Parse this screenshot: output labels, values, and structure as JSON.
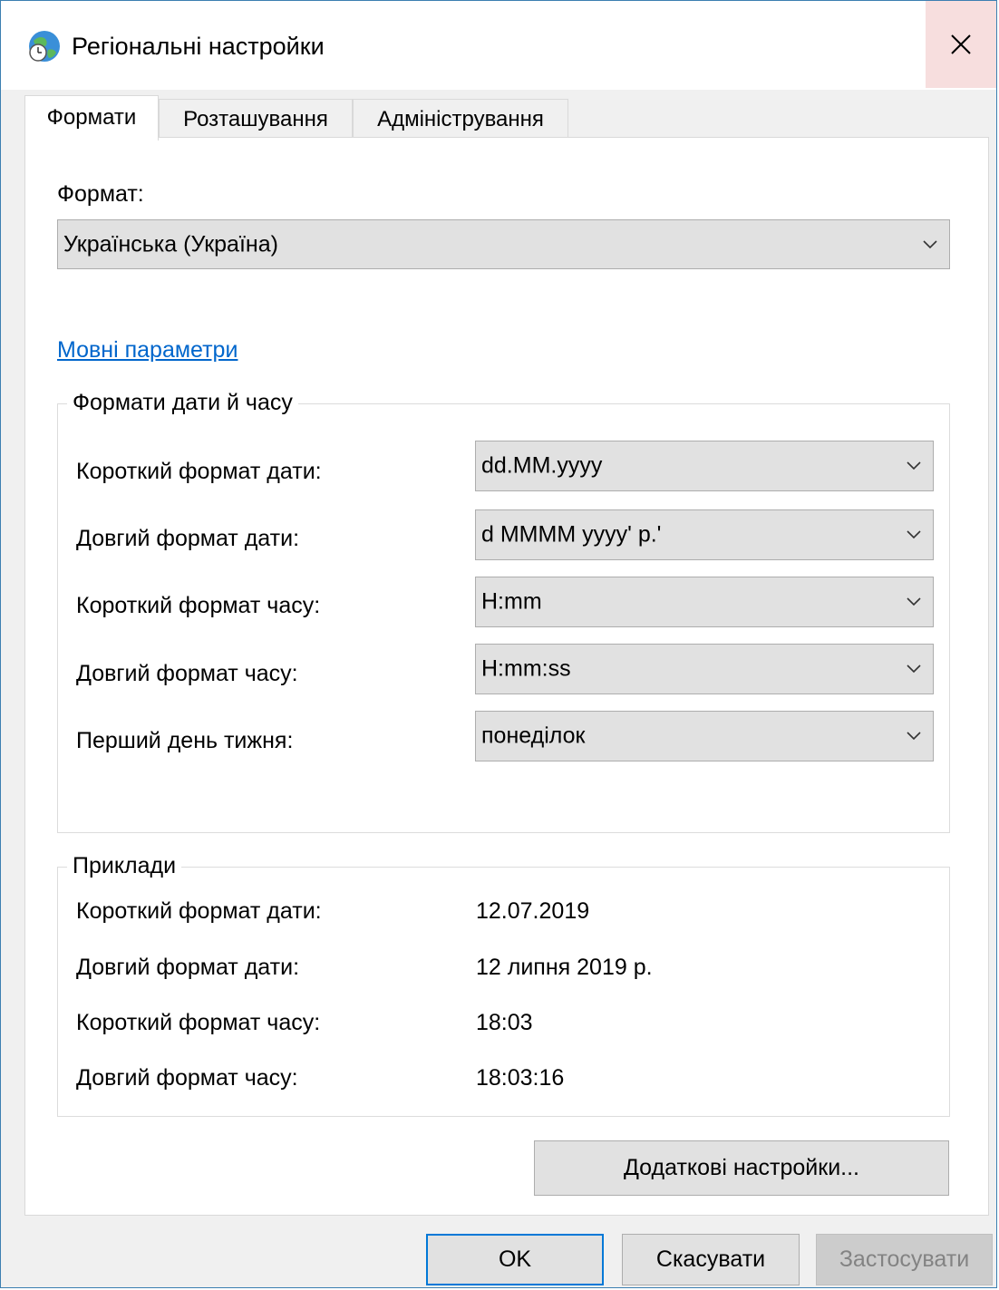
{
  "window": {
    "title": "Регіональні настройки",
    "close_glyph": "✕"
  },
  "tabs": [
    {
      "label": "Формати",
      "active": true
    },
    {
      "label": "Розташування",
      "active": false
    },
    {
      "label": "Адміністрування",
      "active": false
    }
  ],
  "format": {
    "label": "Формат:",
    "value": "Українська (Україна)"
  },
  "language_link": "Мовні параметри",
  "date_time_group": {
    "title": "Формати дати й часу",
    "rows": [
      {
        "label": "Короткий формат дати:",
        "value": "dd.MM.yyyy"
      },
      {
        "label": "Довгий формат дати:",
        "value": "d MMMM yyyy' р.'"
      },
      {
        "label": "Короткий формат часу:",
        "value": "H:mm"
      },
      {
        "label": "Довгий формат часу:",
        "value": "H:mm:ss"
      },
      {
        "label": "Перший день тижня:",
        "value": "понеділок"
      }
    ]
  },
  "examples_group": {
    "title": "Приклади",
    "rows": [
      {
        "label": "Короткий формат дати:",
        "value": "12.07.2019"
      },
      {
        "label": "Довгий формат дати:",
        "value": "12 липня 2019 р."
      },
      {
        "label": "Короткий формат часу:",
        "value": "18:03"
      },
      {
        "label": "Довгий формат часу:",
        "value": "18:03:16"
      }
    ]
  },
  "buttons": {
    "additional": "Додаткові настройки...",
    "ok": "OK",
    "cancel": "Скасувати",
    "apply": "Застосувати"
  },
  "colors": {
    "accent": "#0078d7",
    "link": "#0066cc",
    "close_hover": "#f7dede"
  }
}
